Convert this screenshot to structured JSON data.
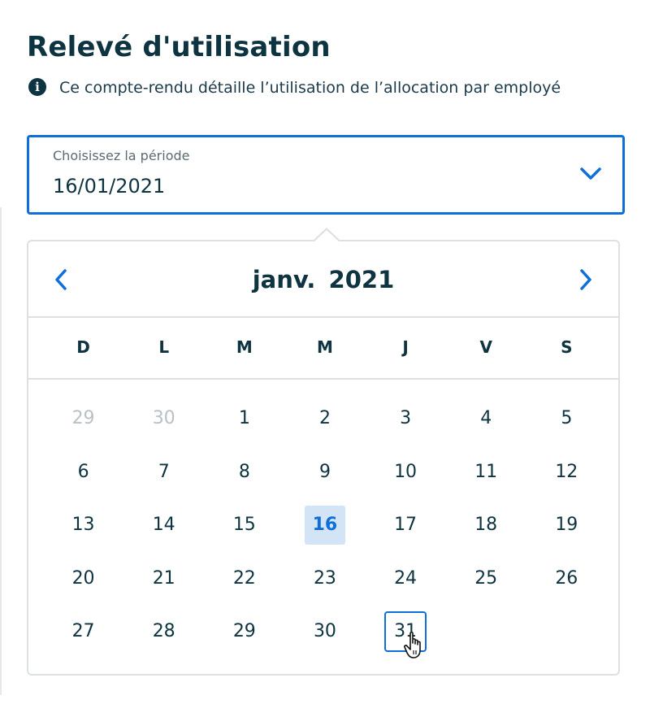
{
  "page": {
    "title": "Relevé d'utilisation",
    "info_text": "Ce compte-rendu détaille l’utilisation de l’allocation par employé"
  },
  "date_field": {
    "label": "Choisissez la période",
    "value": "16/01/2021"
  },
  "calendar": {
    "month_label": "janv.  2021",
    "weekdays": [
      "D",
      "L",
      "M",
      "M",
      "J",
      "V",
      "S"
    ],
    "weeks": [
      [
        {
          "label": "29",
          "muted": true
        },
        {
          "label": "30",
          "muted": true
        },
        {
          "label": "1"
        },
        {
          "label": "2"
        },
        {
          "label": "3"
        },
        {
          "label": "4"
        },
        {
          "label": "5"
        }
      ],
      [
        {
          "label": "6"
        },
        {
          "label": "7"
        },
        {
          "label": "8"
        },
        {
          "label": "9"
        },
        {
          "label": "10"
        },
        {
          "label": "11"
        },
        {
          "label": "12"
        }
      ],
      [
        {
          "label": "13"
        },
        {
          "label": "14"
        },
        {
          "label": "15"
        },
        {
          "label": "16",
          "selected": true
        },
        {
          "label": "17"
        },
        {
          "label": "18"
        },
        {
          "label": "19"
        }
      ],
      [
        {
          "label": "20"
        },
        {
          "label": "21"
        },
        {
          "label": "22"
        },
        {
          "label": "23"
        },
        {
          "label": "24"
        },
        {
          "label": "25"
        },
        {
          "label": "26"
        }
      ],
      [
        {
          "label": "27"
        },
        {
          "label": "28"
        },
        {
          "label": "29"
        },
        {
          "label": "30"
        },
        {
          "label": "31",
          "hover": true
        }
      ]
    ]
  },
  "colors": {
    "accent": "#0f6fd9",
    "text": "#0e3341",
    "muted": "#b9c1c6",
    "selected_bg": "#d3e4f7"
  },
  "icons": {
    "info": "info-icon",
    "dropdown": "chevron-down-icon",
    "prev": "chevron-left-icon",
    "next": "chevron-right-icon",
    "cursor": "hand-pointer-icon"
  }
}
